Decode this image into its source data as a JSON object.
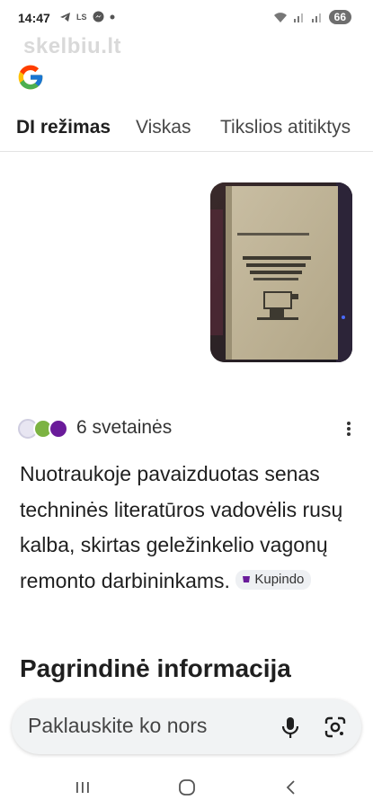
{
  "status_bar": {
    "time": "14:47",
    "left_icons": [
      "telegram-icon",
      "ls-badge",
      "messenger-icon",
      "dot-icon"
    ],
    "ls_label": "LS",
    "battery": "66"
  },
  "watermark": "skelbiu.lt",
  "tabs": [
    {
      "label": "DI režimas",
      "active": true
    },
    {
      "label": "Viskas",
      "active": false
    },
    {
      "label": "Tikslios atitiktys",
      "active": false
    }
  ],
  "sources": {
    "count_label": "6 svetainės",
    "icon_colors": [
      "#e8e6f2",
      "#7cb342",
      "#6a1b9a"
    ]
  },
  "answer": {
    "text": "Nuotraukoje pavaizduotas senas techninės literatūros vadovėlis rusų kalba, skirtas geležinkelio vagonų remonto darbininkams.",
    "chip_label": "Kupindo",
    "chip_icon_color": "#6a1b9a"
  },
  "heading": "Pagrindinė informacija",
  "ask": {
    "placeholder": "Paklauskite ko nors"
  },
  "colors": {
    "accent_text": "#1f1f1f",
    "tab_inactive": "#474747",
    "ask_bg": "#f1f3f4"
  }
}
